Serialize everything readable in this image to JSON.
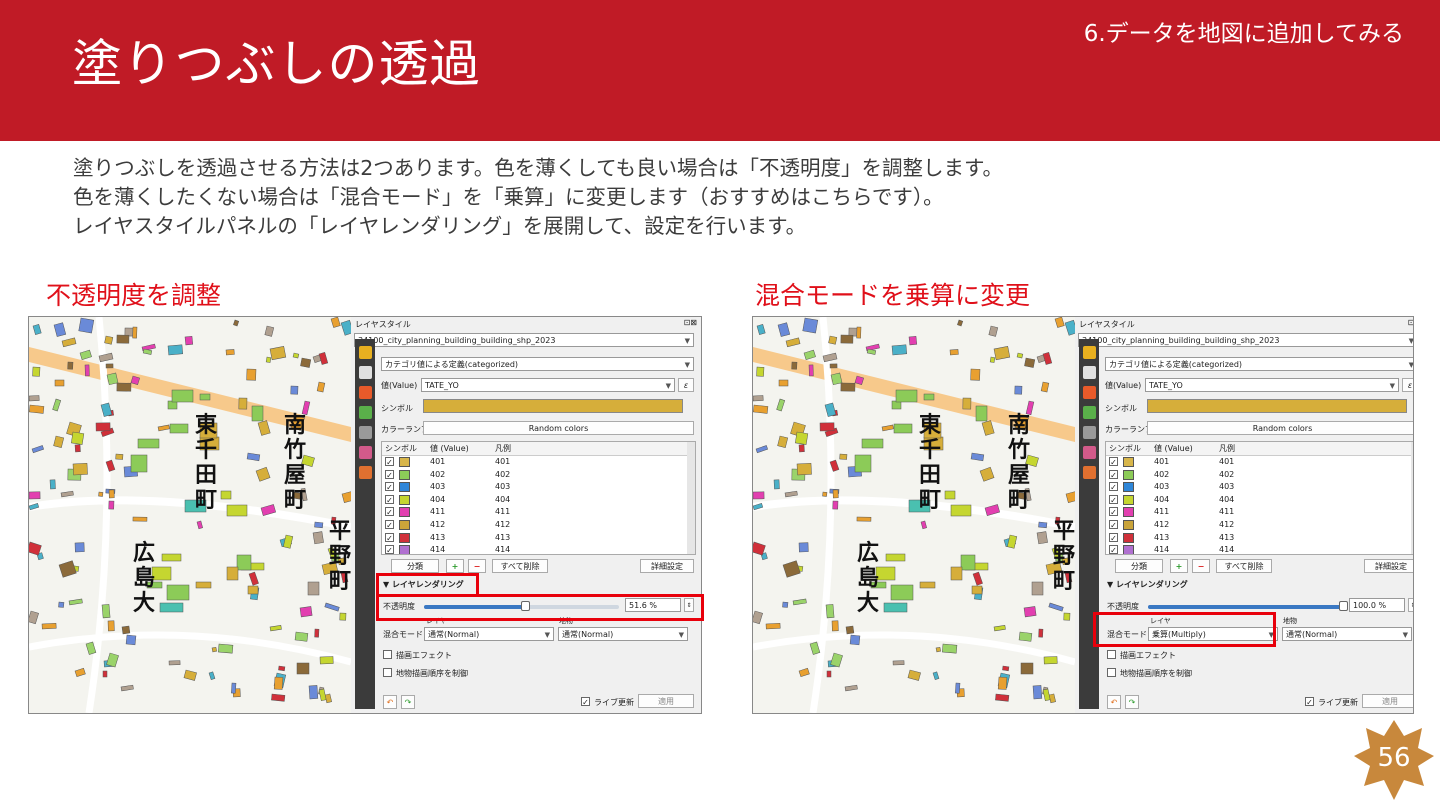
{
  "header": {
    "title": "塗りつぶしの透過",
    "section": "6.データを地図に追加してみる"
  },
  "body": {
    "lines": [
      "塗りつぶしを透過させる方法は2つあります。色を薄くしても良い場合は「不透明度」を調整します。",
      "色を薄くしたくない場合は「混合モード」を「乗算」に変更します（おすすめはこちらです）。",
      "レイヤスタイルパネルの「レイヤレンダリング」を展開して、設定を行います。"
    ]
  },
  "left": {
    "caption": "不透明度を調整",
    "opacity_value": "51.6 %",
    "opacity_fraction": 0.516,
    "blend_layer": "通常(Normal)",
    "blend_feature": "通常(Normal)"
  },
  "right": {
    "caption": "混合モードを乗算に変更",
    "opacity_value": "100.0 %",
    "opacity_fraction": 1.0,
    "blend_layer": "乗算(Multiply)",
    "blend_feature": "通常(Normal)"
  },
  "panel": {
    "title": "レイヤスタイル",
    "layer": "34100_city_planning_building_building_shp_2023",
    "renderer": "カテゴリ値による定義(categorized)",
    "value_label": "値(Value)",
    "value_field": "TATE_YO",
    "symbol_label": "シンボル",
    "ramp_label": "カラーランプ",
    "ramp_value": "Random colors",
    "col_symbol": "シンボル",
    "col_value": "値 (Value)",
    "col_legend": "凡例",
    "classify_btn": "分類",
    "delete_all_btn": "すべて削除",
    "advanced_btn": "詳細設定",
    "rendering_title": "レイヤレンダリング",
    "opacity_label": "不透明度",
    "blend_label": "混合モード",
    "blend_layer_head": "レイヤ",
    "blend_feature_head": "地物",
    "effects_label": "描画エフェクト",
    "order_label": "地物描画順序を制御",
    "live_update": "ライブ更新",
    "apply_btn": "適用",
    "rows": [
      {
        "value": "401",
        "legend": "401",
        "color": "#d8b64a"
      },
      {
        "value": "402",
        "legend": "402",
        "color": "#8ccb58"
      },
      {
        "value": "403",
        "legend": "403",
        "color": "#2f86d8"
      },
      {
        "value": "404",
        "legend": "404",
        "color": "#c5d630"
      },
      {
        "value": "411",
        "legend": "411",
        "color": "#e23fb0"
      },
      {
        "value": "412",
        "legend": "412",
        "color": "#caa43a"
      },
      {
        "value": "413",
        "legend": "413",
        "color": "#d0303a"
      },
      {
        "value": "414",
        "legend": "414",
        "color": "#b070d0"
      }
    ]
  },
  "map": {
    "labels": [
      "東",
      "千",
      "田",
      "町",
      "南",
      "竹",
      "屋",
      "町",
      "広",
      "島",
      "大",
      "平",
      "野",
      "町"
    ]
  },
  "page_number": "56"
}
